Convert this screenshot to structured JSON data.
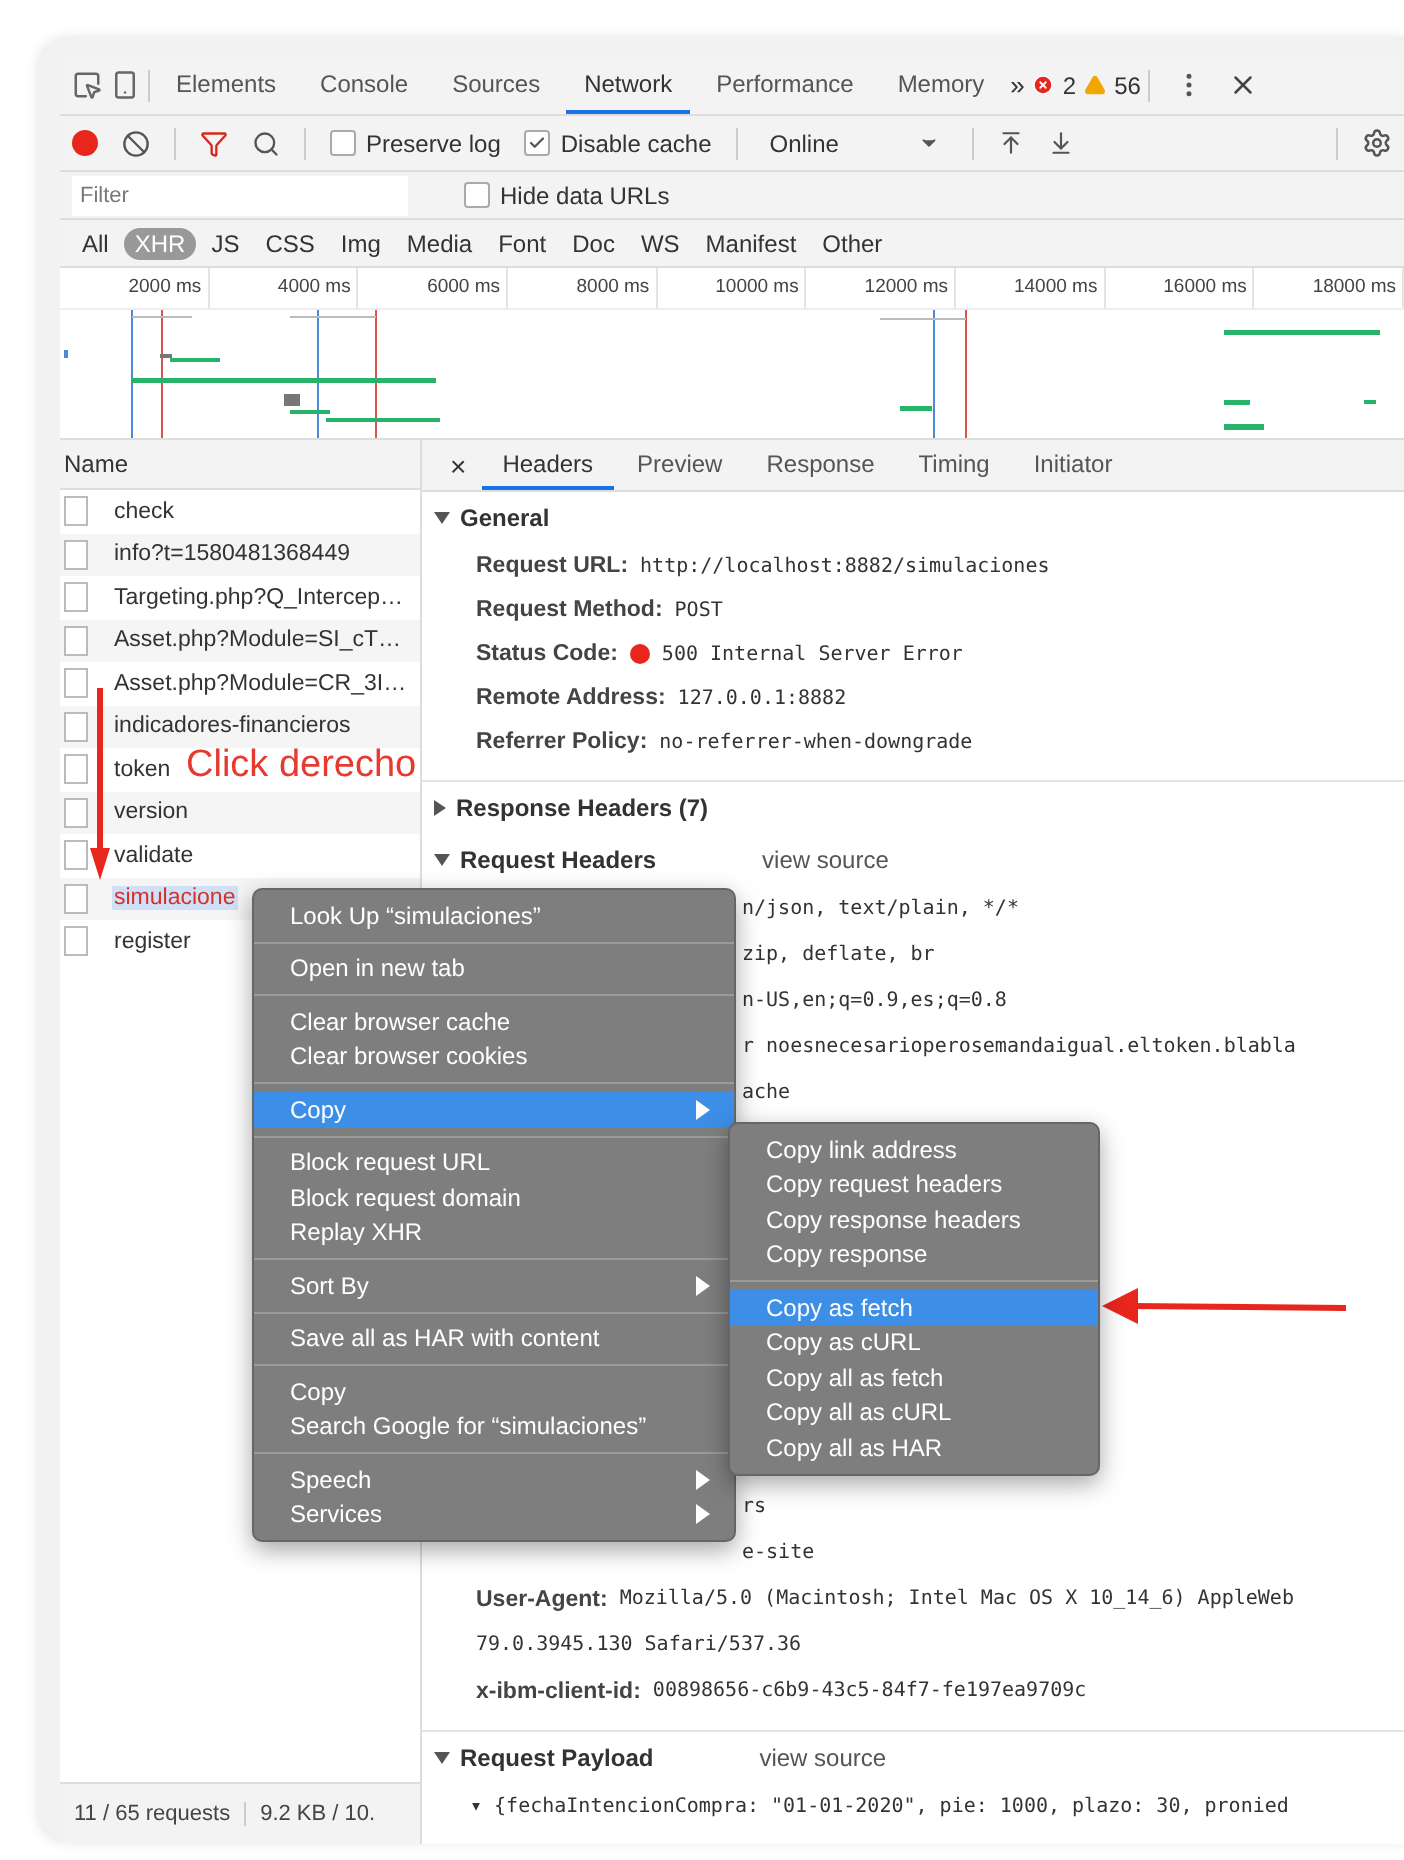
{
  "devtools_tabs": [
    {
      "label": "Elements",
      "selected": false
    },
    {
      "label": "Console",
      "selected": false
    },
    {
      "label": "Sources",
      "selected": false
    },
    {
      "label": "Network",
      "selected": true
    },
    {
      "label": "Performance",
      "selected": false
    },
    {
      "label": "Memory",
      "selected": false
    }
  ],
  "more_tabs": "»",
  "error_count": "2",
  "warning_count": "56",
  "toolbar": {
    "recording": true,
    "preserve_log": {
      "label": "Preserve log",
      "checked": false
    },
    "disable_cache": {
      "label": "Disable cache",
      "checked": true
    },
    "throttling": "Online"
  },
  "filter": {
    "placeholder": "Filter",
    "hide_data_urls": {
      "label": "Hide data URLs",
      "checked": false
    }
  },
  "type_filters": [
    {
      "label": "All",
      "selected": false
    },
    {
      "label": "XHR",
      "selected": true
    },
    {
      "label": "JS",
      "selected": false
    },
    {
      "label": "CSS",
      "selected": false
    },
    {
      "label": "Img",
      "selected": false
    },
    {
      "label": "Media",
      "selected": false
    },
    {
      "label": "Font",
      "selected": false
    },
    {
      "label": "Doc",
      "selected": false
    },
    {
      "label": "WS",
      "selected": false
    },
    {
      "label": "Manifest",
      "selected": false
    },
    {
      "label": "Other",
      "selected": false
    }
  ],
  "timeline_ticks": [
    "2000 ms",
    "4000 ms",
    "6000 ms",
    "8000 ms",
    "10000 ms",
    "12000 ms",
    "14000 ms",
    "16000 ms",
    "18000 ms"
  ],
  "requests": {
    "column": "Name",
    "rows": [
      {
        "name": "check",
        "selected": false,
        "failed": false
      },
      {
        "name": "info?t=1580481368449",
        "selected": false,
        "failed": false
      },
      {
        "name": "Targeting.php?Q_Intercep…",
        "selected": false,
        "failed": false
      },
      {
        "name": "Asset.php?Module=SI_cT…",
        "selected": false,
        "failed": false
      },
      {
        "name": "Asset.php?Module=CR_3I…",
        "selected": false,
        "failed": false
      },
      {
        "name": "indicadores-financieros",
        "selected": false,
        "failed": false
      },
      {
        "name": "token",
        "selected": false,
        "failed": false
      },
      {
        "name": "version",
        "selected": false,
        "failed": false
      },
      {
        "name": "validate",
        "selected": false,
        "failed": false
      },
      {
        "name": "simulacione",
        "selected": true,
        "failed": true
      },
      {
        "name": "register",
        "selected": false,
        "failed": false
      }
    ]
  },
  "status_bar": [
    "11 / 65 requests",
    "9.2 KB / 10."
  ],
  "details": {
    "close": "×",
    "tabs": [
      {
        "label": "Headers",
        "selected": true
      },
      {
        "label": "Preview",
        "selected": false
      },
      {
        "label": "Response",
        "selected": false
      },
      {
        "label": "Timing",
        "selected": false
      },
      {
        "label": "Initiator",
        "selected": false
      }
    ],
    "general": {
      "title": "General",
      "expanded": true,
      "fields": [
        {
          "kind": "field",
          "label": "Request URL:",
          "value": "http://localhost:8882/simulaciones"
        },
        {
          "kind": "field",
          "label": "Request Method:",
          "value": "POST"
        },
        {
          "kind": "status",
          "label": "Status Code:",
          "value": "500 Internal Server Error"
        },
        {
          "kind": "field",
          "label": "Remote Address:",
          "value": "127.0.0.1:8882"
        },
        {
          "kind": "field",
          "label": "Referrer Policy:",
          "value": "no-referrer-when-downgrade"
        }
      ]
    },
    "response_headers": {
      "title": "Response Headers (7)",
      "expanded": false
    },
    "request_headers": {
      "title": "Request Headers",
      "expanded": true,
      "link": "view source",
      "lines": [
        {
          "kind": "partial",
          "text": "n/json, text/plain, */*"
        },
        {
          "kind": "partial",
          "text": "zip, deflate, br"
        },
        {
          "kind": "partial",
          "text": "n-US,en;q=0.9,es;q=0.8"
        },
        {
          "kind": "partial",
          "text": "r noesnecesarioperosemandaigual.eltoken.blabla"
        },
        {
          "kind": "partial",
          "text": "ache"
        },
        {
          "kind": "covered"
        },
        {
          "kind": "covered"
        },
        {
          "kind": "covered"
        },
        {
          "kind": "covered"
        },
        {
          "kind": "covered"
        },
        {
          "kind": "covered"
        },
        {
          "kind": "covered"
        },
        {
          "kind": "covered"
        },
        {
          "kind": "partial",
          "text": "rs"
        },
        {
          "kind": "partial",
          "text": "e-site"
        },
        {
          "kind": "field",
          "label": "User-Agent:",
          "value": "Mozilla/5.0 (Macintosh; Intel Mac OS X 10_14_6) AppleWeb"
        },
        {
          "kind": "continuation",
          "text": "79.0.3945.130 Safari/537.36"
        },
        {
          "kind": "field",
          "label": "x-ibm-client-id:",
          "value": "00898656-c6b9-43c5-84f7-fe197ea9709c"
        }
      ]
    },
    "request_payload": {
      "title": "Request Payload",
      "expanded": true,
      "link": "view source",
      "line": "▾ {fechaIntencionCompra: \"01-01-2020\", pie: 1000, plazo: 30, pronied"
    }
  },
  "context_menu": [
    [
      {
        "label": "Look Up “simulaciones”",
        "selected": false,
        "submenu": false
      }
    ],
    [
      {
        "label": "Open in new tab",
        "selected": false,
        "submenu": false
      }
    ],
    [
      {
        "label": "Clear browser cache",
        "selected": false,
        "submenu": false
      },
      {
        "label": "Clear browser cookies",
        "selected": false,
        "submenu": false
      }
    ],
    [
      {
        "label": "Copy",
        "selected": true,
        "submenu": true
      }
    ],
    [
      {
        "label": "Block request URL",
        "selected": false,
        "submenu": false
      },
      {
        "label": "Block request domain",
        "selected": false,
        "submenu": false
      },
      {
        "label": "Replay XHR",
        "selected": false,
        "submenu": false
      }
    ],
    [
      {
        "label": "Sort By",
        "selected": false,
        "submenu": true
      }
    ],
    [
      {
        "label": "Save all as HAR with content",
        "selected": false,
        "submenu": false
      }
    ],
    [
      {
        "label": "Copy",
        "selected": false,
        "submenu": false
      },
      {
        "label": "Search Google for “simulaciones”",
        "selected": false,
        "submenu": false
      }
    ],
    [
      {
        "label": "Speech",
        "selected": false,
        "submenu": true
      },
      {
        "label": "Services",
        "selected": false,
        "submenu": true
      }
    ]
  ],
  "copy_submenu": [
    [
      {
        "label": "Copy link address",
        "selected": false
      },
      {
        "label": "Copy request headers",
        "selected": false
      },
      {
        "label": "Copy response headers",
        "selected": false
      },
      {
        "label": "Copy response",
        "selected": false
      }
    ],
    [
      {
        "label": "Copy as fetch",
        "selected": true
      },
      {
        "label": "Copy as cURL",
        "selected": false
      },
      {
        "label": "Copy all as fetch",
        "selected": false
      },
      {
        "label": "Copy all as cURL",
        "selected": false
      },
      {
        "label": "Copy all as HAR",
        "selected": false
      }
    ]
  ],
  "annotation": "Click derecho"
}
